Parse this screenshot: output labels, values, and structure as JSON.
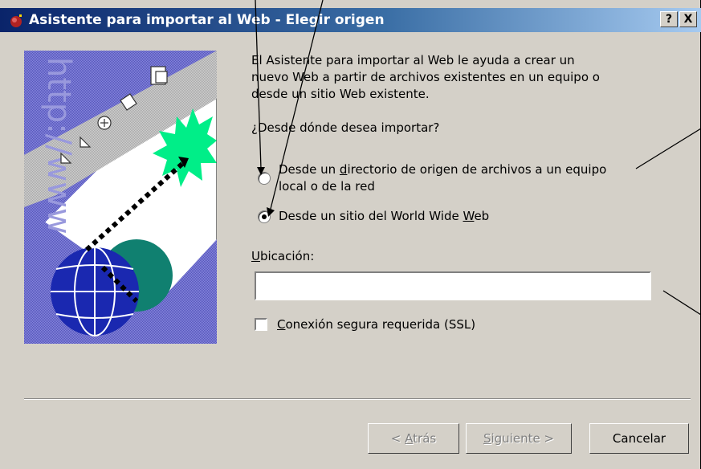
{
  "window": {
    "title": "Asistente para importar al Web - Elegir origen",
    "help_label": "?",
    "close_label": "X"
  },
  "intro": {
    "line1": "El Asistente para importar al Web le ayuda a crear un",
    "line2": "nuevo Web a partir de archivos existentes en un equipo o",
    "line3": "desde un sitio Web existente."
  },
  "question": "¿Desde dónde desea importar?",
  "options": [
    {
      "line1_pre": "Desde un ",
      "line1_ul": "d",
      "line1_post": "irectorio de origen de archivos a un equipo",
      "line2": "local o de la red",
      "selected": false
    },
    {
      "pre": "Desde un sitio del World Wide ",
      "ul": "W",
      "post": "eb",
      "selected": true
    }
  ],
  "location": {
    "label_ul": "U",
    "label_rest": "bicación:",
    "value": ""
  },
  "ssl": {
    "label_ul": "C",
    "label_rest": "onexión segura requerida (SSL)",
    "checked": false
  },
  "buttons": {
    "back_pre": "< ",
    "back_ul": "A",
    "back_post": "trás",
    "next_ul": "S",
    "next_post": "iguiente >",
    "cancel": "Cancelar"
  },
  "art": {
    "vertical_text": "http://www"
  },
  "colors": {
    "title_start": "#0a246a",
    "title_end": "#a6caf0",
    "panel": "#d4d0c8",
    "burst": "#00ee88",
    "globe_blue": "#1a28b0",
    "globe_teal": "#108070",
    "diag_purple": "#6666cc"
  }
}
